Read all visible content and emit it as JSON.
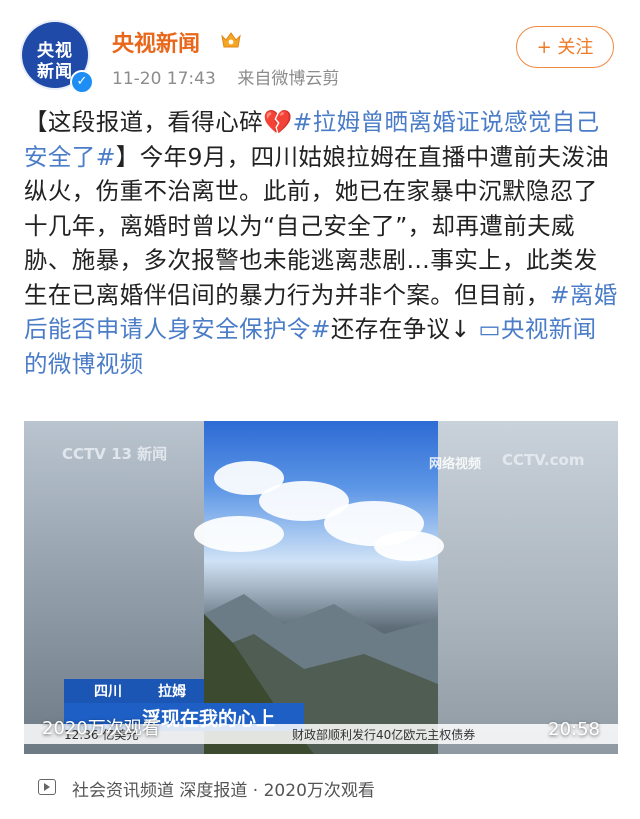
{
  "post": {
    "avatar_text_line1": "央视",
    "avatar_text_line2": "新闻",
    "author": "央视新闻",
    "time": "11-20 17:43",
    "source": "来自微博云剪",
    "follow_label": "+ 关注"
  },
  "content": {
    "open_bracket": "【这段报道，看得心碎",
    "heart": "💔",
    "topic1": "#拉姆曾晒离婚证说感觉自己安全了#",
    "body1": "】今年9月，四川姑娘拉姆在直播中遭前夫泼油纵火，伤重不治离世。此前，她已在家暴中沉默隐忍了十几年，离婚时曾以为“自己安全了”，却再遭前夫威胁、施暴，多次报警也未能逃离悲剧…事实上，此类发生在已离婚伴侣间的暴力行为并非个案。但目前，",
    "topic2": "#离婚后能否申请人身安全保护令#",
    "body2": "还存在争议↓ ",
    "video_link": "▭央视新闻的微博视频"
  },
  "video": {
    "watermark_left": "CCTV 13 新闻",
    "watermark_right_tag": "网络视频",
    "watermark_right": "CCTV.com",
    "lower_label_1": "四川",
    "lower_label_2": "拉姆",
    "subtitle": "浮现在我的心上",
    "ticker_left": "12:36 亿美元",
    "ticker": "财政部顺利发行40亿欧元主权债券",
    "views": "2020万次观看",
    "duration": "20:58"
  },
  "footer": {
    "text": "社会资讯频道 深度报道 · 2020万次观看"
  },
  "colors": {
    "author": "#e8671a",
    "topic": "#4a7cc8",
    "follow": "#ef7a25"
  },
  "icons": [
    "verified-icon",
    "vip-crown-icon",
    "video-link-icon",
    "video-channel-icon"
  ]
}
